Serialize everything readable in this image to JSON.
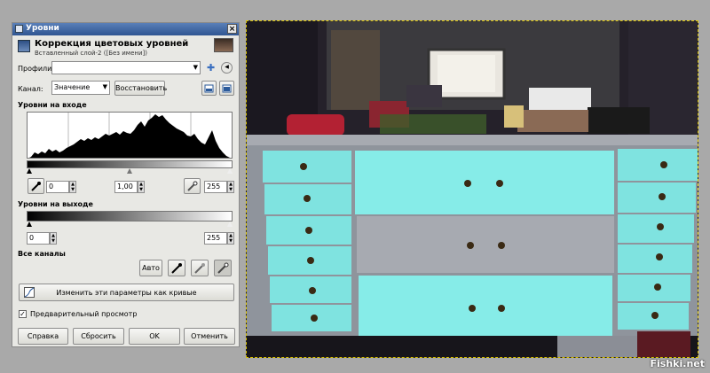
{
  "window": {
    "title": "Уровни",
    "close": "×"
  },
  "header": {
    "title": "Коррекция цветовых уровней",
    "subtitle": "Вставленный слой-2 ([Без имени])"
  },
  "profiles": {
    "label": "Профили:",
    "value": ""
  },
  "channel": {
    "label": "Канал:",
    "value": "Значение",
    "reset_label": "Восстановить"
  },
  "input_levels": {
    "label": "Уровни на входе",
    "low": "0",
    "gamma": "1,00",
    "high": "255"
  },
  "output_levels": {
    "label": "Уровни на выходе",
    "low": "0",
    "high": "255"
  },
  "all_channels": {
    "label": "Все каналы",
    "auto_label": "Авто"
  },
  "curves_button": {
    "label": "Изменить эти параметры как кривые"
  },
  "preview": {
    "label": "Предварительный просмотр",
    "checked": true
  },
  "buttons": {
    "help": "Справка",
    "reset": "Сбросить",
    "ok": "OK",
    "cancel": "Отменить"
  },
  "watermark": "Fishki.net",
  "colors": {
    "titlebar": "#2f5592",
    "dresser_aqua": "#7fe3e0",
    "dresser_grey": "#a7aab1",
    "background": "#a9a9a9"
  },
  "icons": [
    "window-icon",
    "close-icon",
    "levels-icon",
    "layer-thumbnail",
    "dropdown-arrow-icon",
    "add-preset-icon",
    "preset-menu-icon",
    "linear-histogram-icon",
    "log-histogram-icon",
    "eyedropper-black-icon",
    "eyedropper-gray-icon",
    "eyedropper-white-icon",
    "curves-icon"
  ]
}
